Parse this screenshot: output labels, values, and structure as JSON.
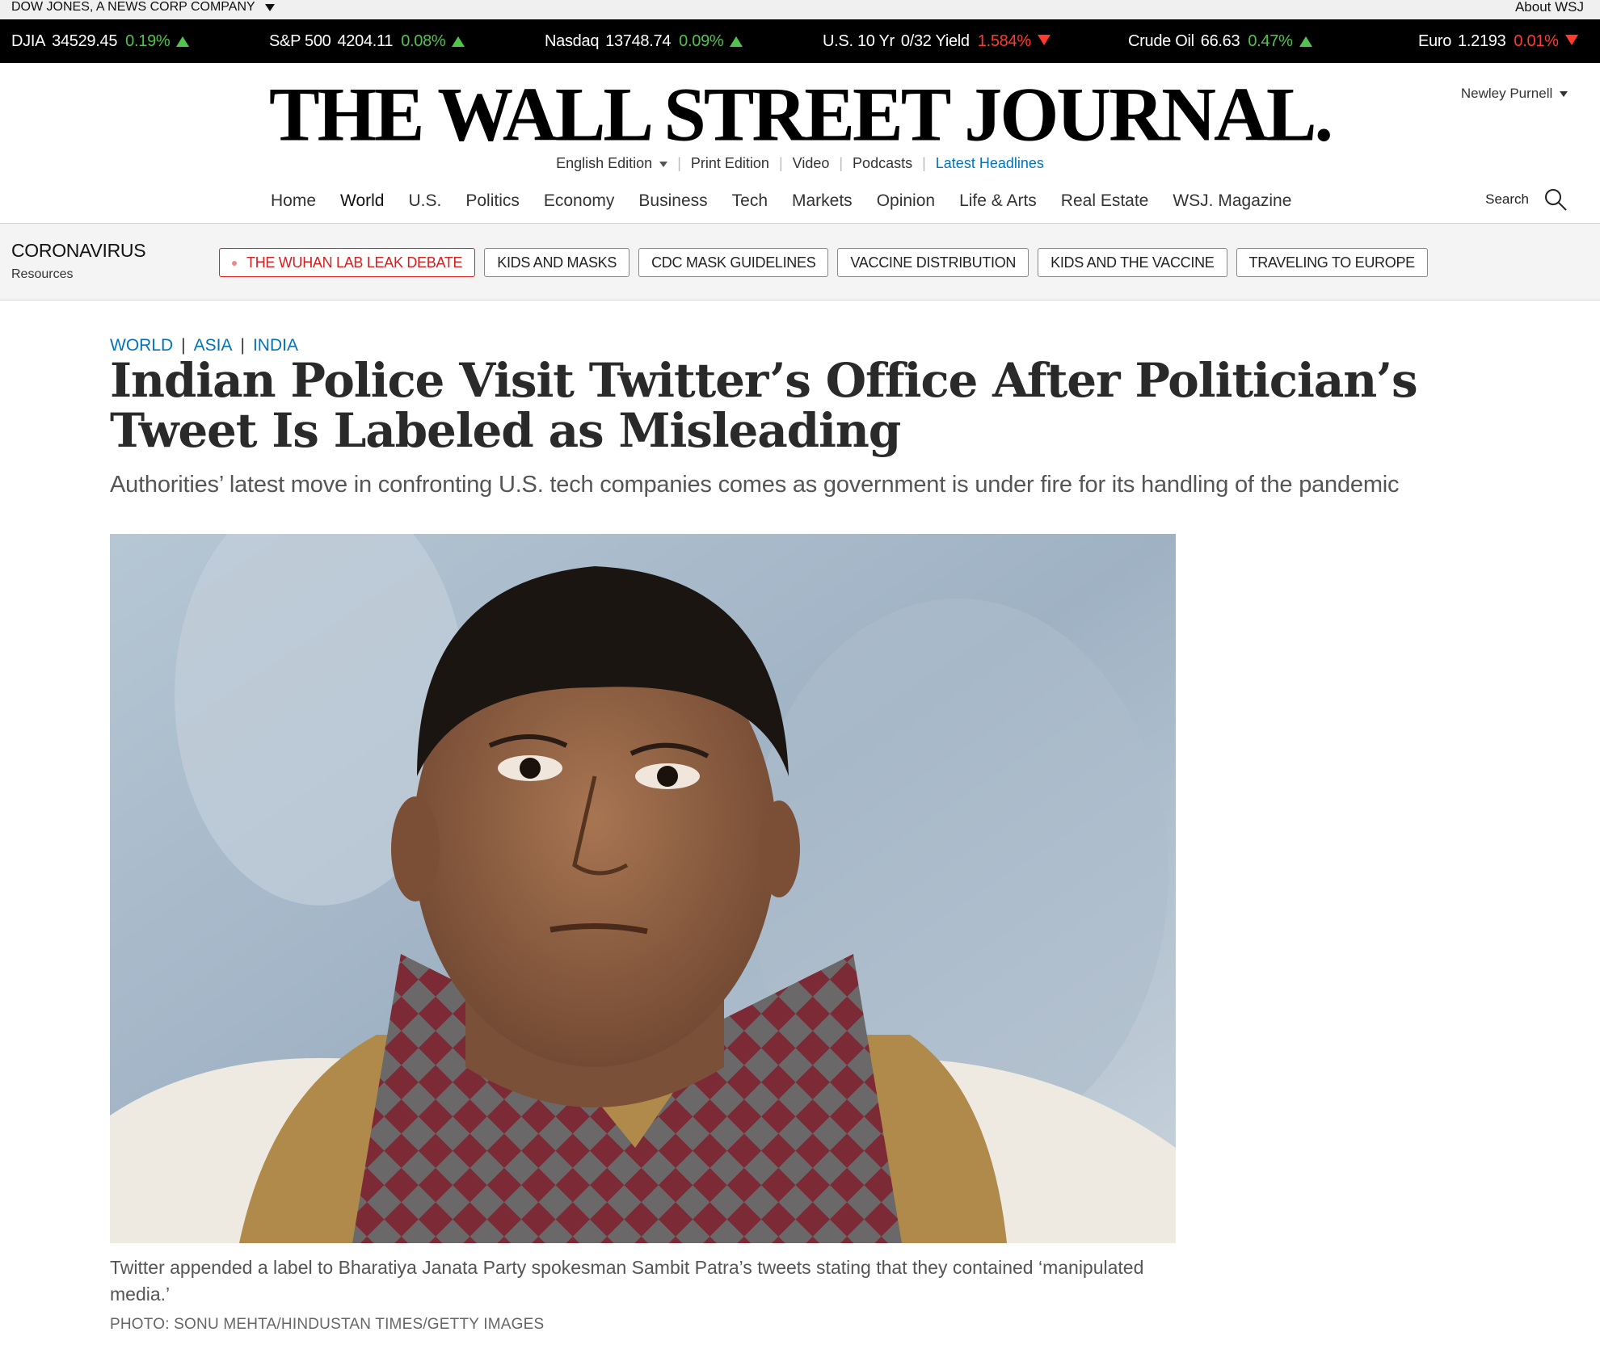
{
  "corp_bar": {
    "company": "DOW JONES, A NEWS CORP COMPANY",
    "about": "About WSJ"
  },
  "ticker": [
    {
      "name": "DJIA",
      "value": "34529.45",
      "change": "0.19%",
      "dir": "up"
    },
    {
      "name": "S&P 500",
      "value": "4204.11",
      "change": "0.08%",
      "dir": "up"
    },
    {
      "name": "Nasdaq",
      "value": "13748.74",
      "change": "0.09%",
      "dir": "up"
    },
    {
      "name": "U.S. 10 Yr",
      "value": "0/32 Yield",
      "change": "1.584%",
      "dir": "down"
    },
    {
      "name": "Crude Oil",
      "value": "66.63",
      "change": "0.47%",
      "dir": "up"
    },
    {
      "name": "Euro",
      "value": "1.2193",
      "change": "0.01%",
      "dir": "down"
    }
  ],
  "masthead": {
    "logo": "THE WALL STREET JOURNAL.",
    "user": "Newley Purnell",
    "editions": {
      "english": "English Edition",
      "print": "Print Edition",
      "video": "Video",
      "podcasts": "Podcasts",
      "latest": "Latest Headlines"
    }
  },
  "nav": {
    "items": [
      "Home",
      "World",
      "U.S.",
      "Politics",
      "Economy",
      "Business",
      "Tech",
      "Markets",
      "Opinion",
      "Life & Arts",
      "Real Estate",
      "WSJ. Magazine"
    ],
    "search_label": "Search"
  },
  "covid": {
    "title": "CORONAVIRUS",
    "subtitle": "Resources",
    "pills": [
      "THE WUHAN LAB LEAK DEBATE",
      "KIDS AND MASKS",
      "CDC MASK GUIDELINES",
      "VACCINE DISTRIBUTION",
      "KIDS AND THE VACCINE",
      "TRAVELING TO EUROPE"
    ]
  },
  "article": {
    "crumbs": [
      "WORLD",
      "ASIA",
      "INDIA"
    ],
    "headline": "Indian Police Visit Twitter’s Office After Politician’s Tweet Is Labeled as Misleading",
    "dek": "Authorities’ latest move in confronting U.S. tech companies comes as government is under fire for its handling of the pandemic",
    "caption": "Twitter appended a label to Bharatiya Janata Party spokesman Sambit Patra’s tweets stating that they contained ‘manipulated media.’",
    "credit": "PHOTO: SONU MEHTA/HINDUSTAN TIMES/GETTY IMAGES"
  },
  "colors": {
    "link_blue": "#0274b6",
    "up_green": "#52c34d",
    "down_red": "#ff3b30",
    "hot_red": "#e02020"
  }
}
